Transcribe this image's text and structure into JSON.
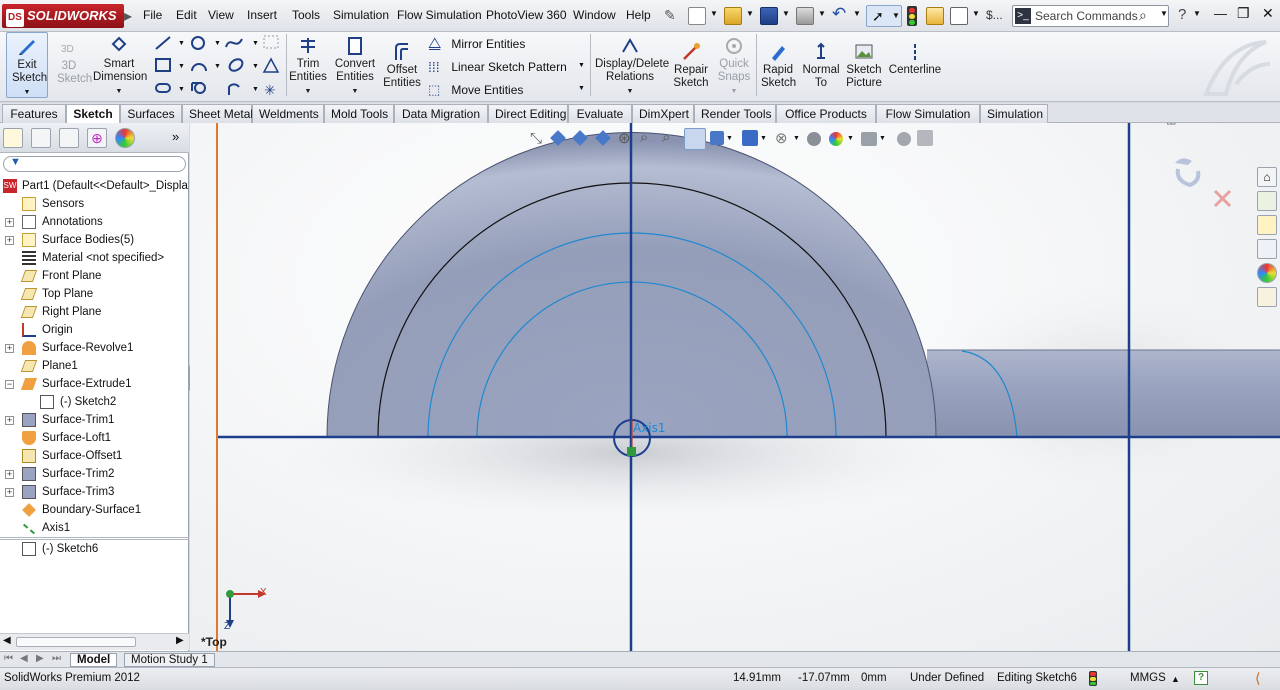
{
  "app": {
    "brand": "SOLIDWORKS",
    "brand_mark": "DS"
  },
  "menu": [
    "File",
    "Edit",
    "View",
    "Insert",
    "Tools",
    "Simulation",
    "Flow Simulation",
    "PhotoView 360",
    "Window",
    "Help"
  ],
  "search": {
    "placeholder": "Search Commands"
  },
  "toolbar": {
    "exit_sketch": "Exit Sketch",
    "sketch_3d": "3D Sketch",
    "smart_dimension": "Smart Dimension",
    "trim_entities": "Trim Entities",
    "convert_entities": "Convert Entities",
    "offset_entities": "Offset Entities",
    "mirror_entities": "Mirror Entities",
    "linear_sketch_pattern": "Linear Sketch Pattern",
    "move_entities": "Move Entities",
    "display_delete_relations": "Display/Delete Relations",
    "repair_sketch": "Repair Sketch",
    "quick_snaps": "Quick Snaps",
    "rapid_sketch": "Rapid Sketch",
    "normal_to": "Normal To",
    "sketch_picture": "Sketch Picture",
    "centerline": "Centerline"
  },
  "tabs": [
    "Features",
    "Sketch",
    "Surfaces",
    "Sheet Metal",
    "Weldments",
    "Mold Tools",
    "Data Migration",
    "Direct Editing",
    "Evaluate",
    "DimXpert",
    "Render Tools",
    "Office Products",
    "Flow Simulation",
    "Simulation"
  ],
  "active_tab": "Sketch",
  "tree": {
    "root": "Part1  (Default<<Default>_Displa",
    "items": [
      {
        "label": "Sensors",
        "icon": "sensor-icon",
        "expandable": false
      },
      {
        "label": "Annotations",
        "icon": "annotations-icon",
        "expandable": true
      },
      {
        "label": "Surface Bodies(5)",
        "icon": "surface-bodies-icon",
        "expandable": true
      },
      {
        "label": "Material <not specified>",
        "icon": "material-icon",
        "expandable": false
      },
      {
        "label": "Front Plane",
        "icon": "plane-icon",
        "expandable": false
      },
      {
        "label": "Top Plane",
        "icon": "plane-icon",
        "expandable": false
      },
      {
        "label": "Right Plane",
        "icon": "plane-icon",
        "expandable": false
      },
      {
        "label": "Origin",
        "icon": "origin-icon",
        "expandable": false
      },
      {
        "label": "Surface-Revolve1",
        "icon": "surface-revolve-icon",
        "expandable": true
      },
      {
        "label": "Plane1",
        "icon": "plane-icon",
        "expandable": false
      },
      {
        "label": "Surface-Extrude1",
        "icon": "surface-extrude-icon",
        "expandable": true,
        "expanded": true
      },
      {
        "label": "(-) Sketch2",
        "icon": "sketch-icon",
        "expandable": false,
        "child": true
      },
      {
        "label": "Surface-Trim1",
        "icon": "surface-trim-icon",
        "expandable": true
      },
      {
        "label": "Surface-Loft1",
        "icon": "surface-loft-icon",
        "expandable": false
      },
      {
        "label": "Surface-Offset1",
        "icon": "surface-offset-icon",
        "expandable": false
      },
      {
        "label": "Surface-Trim2",
        "icon": "surface-trim-icon",
        "expandable": true
      },
      {
        "label": "Surface-Trim3",
        "icon": "surface-trim-icon",
        "expandable": true
      },
      {
        "label": "Boundary-Surface1",
        "icon": "boundary-surface-icon",
        "expandable": false
      },
      {
        "label": "Axis1",
        "icon": "axis-icon",
        "expandable": false
      },
      {
        "label": "(-) Sketch6",
        "icon": "sketch-icon",
        "expandable": false,
        "active": true
      }
    ]
  },
  "viewport": {
    "view_label": "*Top",
    "axis_label": "Axis1",
    "triad_x": "X",
    "triad_z": "Z"
  },
  "bottom_tabs": [
    "Model",
    "Motion Study 1"
  ],
  "status": {
    "product": "SolidWorks Premium 2012",
    "x": "14.91mm",
    "y": "-17.07mm",
    "z": "0mm",
    "state": "Under Defined",
    "editing": "Editing Sketch6",
    "units": "MMGS",
    "help": "?"
  },
  "colors": {
    "accent": "#1c3e8c",
    "brand": "#b41d23",
    "part": "#9aa4c2",
    "sketch_blue": "#1e88d0"
  }
}
